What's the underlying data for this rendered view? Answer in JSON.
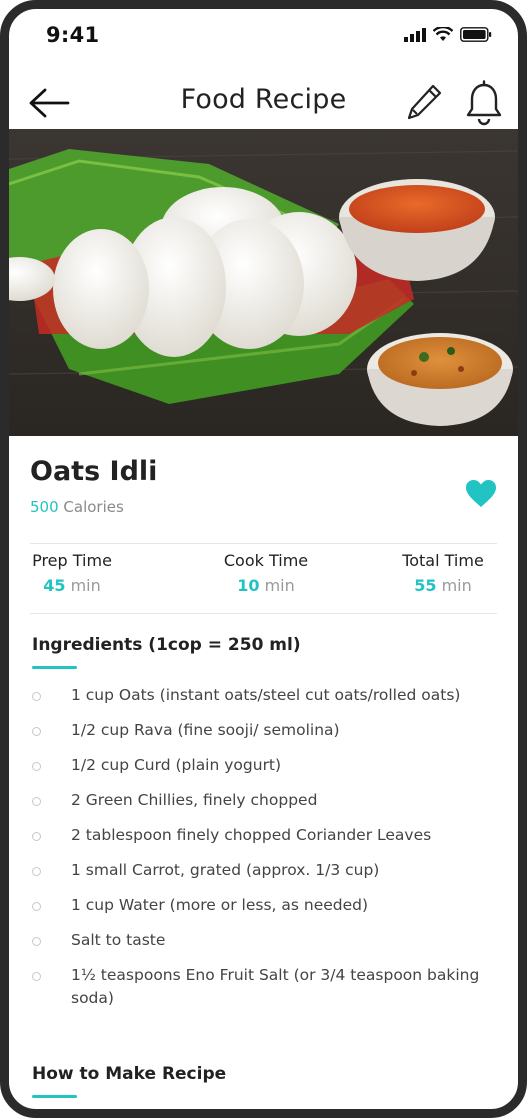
{
  "status_bar": {
    "time": "9:41"
  },
  "header": {
    "title": "Food Recipe"
  },
  "recipe": {
    "name": "Oats Idli",
    "calories_value": "500",
    "calories_label": "Calories",
    "favorite": true
  },
  "times": [
    {
      "label": "Prep Time",
      "value": "45",
      "unit": "min"
    },
    {
      "label": "Cook Time",
      "value": "10",
      "unit": "min"
    },
    {
      "label": "Total Time",
      "value": "55",
      "unit": "min"
    }
  ],
  "ingredients": {
    "title": "Ingredients (1cop = 250 ml)",
    "items": [
      "1 cup Oats (instant oats/steel cut oats/rolled oats)",
      "1/2 cup Rava (fine sooji/ semolina)",
      "1/2 cup Curd (plain yogurt)",
      "2 Green Chillies, finely chopped",
      "2 tablespoon finely chopped Coriander Leaves",
      "1 small Carrot, grated (approx. 1/3 cup)",
      "1 cup Water (more or less, as needed)",
      "Salt to taste",
      "1½ teaspoons Eno Fruit Salt (or 3/4 teaspoon baking soda)"
    ]
  },
  "how_to": {
    "title": "How to Make Recipe"
  },
  "colors": {
    "accent": "#22c3c3",
    "text": "#222222",
    "muted": "#8a8a8a"
  }
}
